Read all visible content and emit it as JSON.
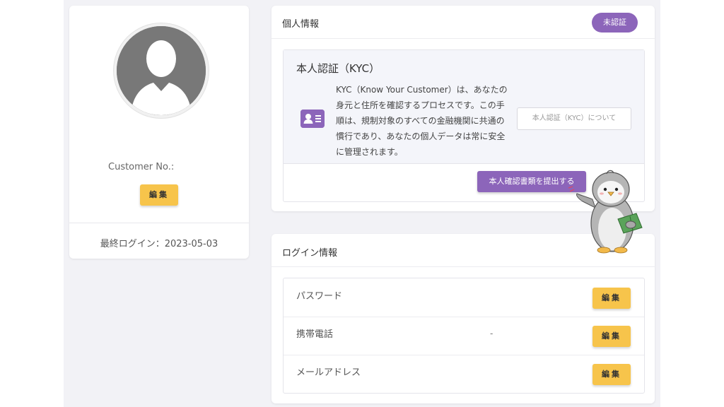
{
  "profile": {
    "customer_no_label": "Customer No.:",
    "edit_label": "編集",
    "last_login": "最終ログイン：2023-05-03"
  },
  "personal_info": {
    "title": "個人情報",
    "status_badge": "未認証",
    "kyc": {
      "title": "本人認証（KYC）",
      "description": "KYC（Know Your Customer）は、あなたの身元と住所を確認するプロセスです。この手順は、規制対象のすべての金融機関に共通の慣行であり、あなたの個人データは常に安全に管理されます。",
      "about_button": "本人認証（KYC）について",
      "submit_button": "本人確認書類を提出する",
      "icon": "id-card-icon"
    }
  },
  "login_info": {
    "title": "ログイン情報",
    "rows": [
      {
        "label": "パスワード",
        "value": "",
        "edit_label": "編集"
      },
      {
        "label": "携帯電話",
        "value": "-",
        "edit_label": "編集"
      },
      {
        "label": "メールアドレス",
        "value": "",
        "edit_label": "編集"
      }
    ]
  },
  "colors": {
    "accent_purple": "#8c65ba",
    "button_yellow": "#f7c44b",
    "page_background": "#f2f2f6"
  }
}
